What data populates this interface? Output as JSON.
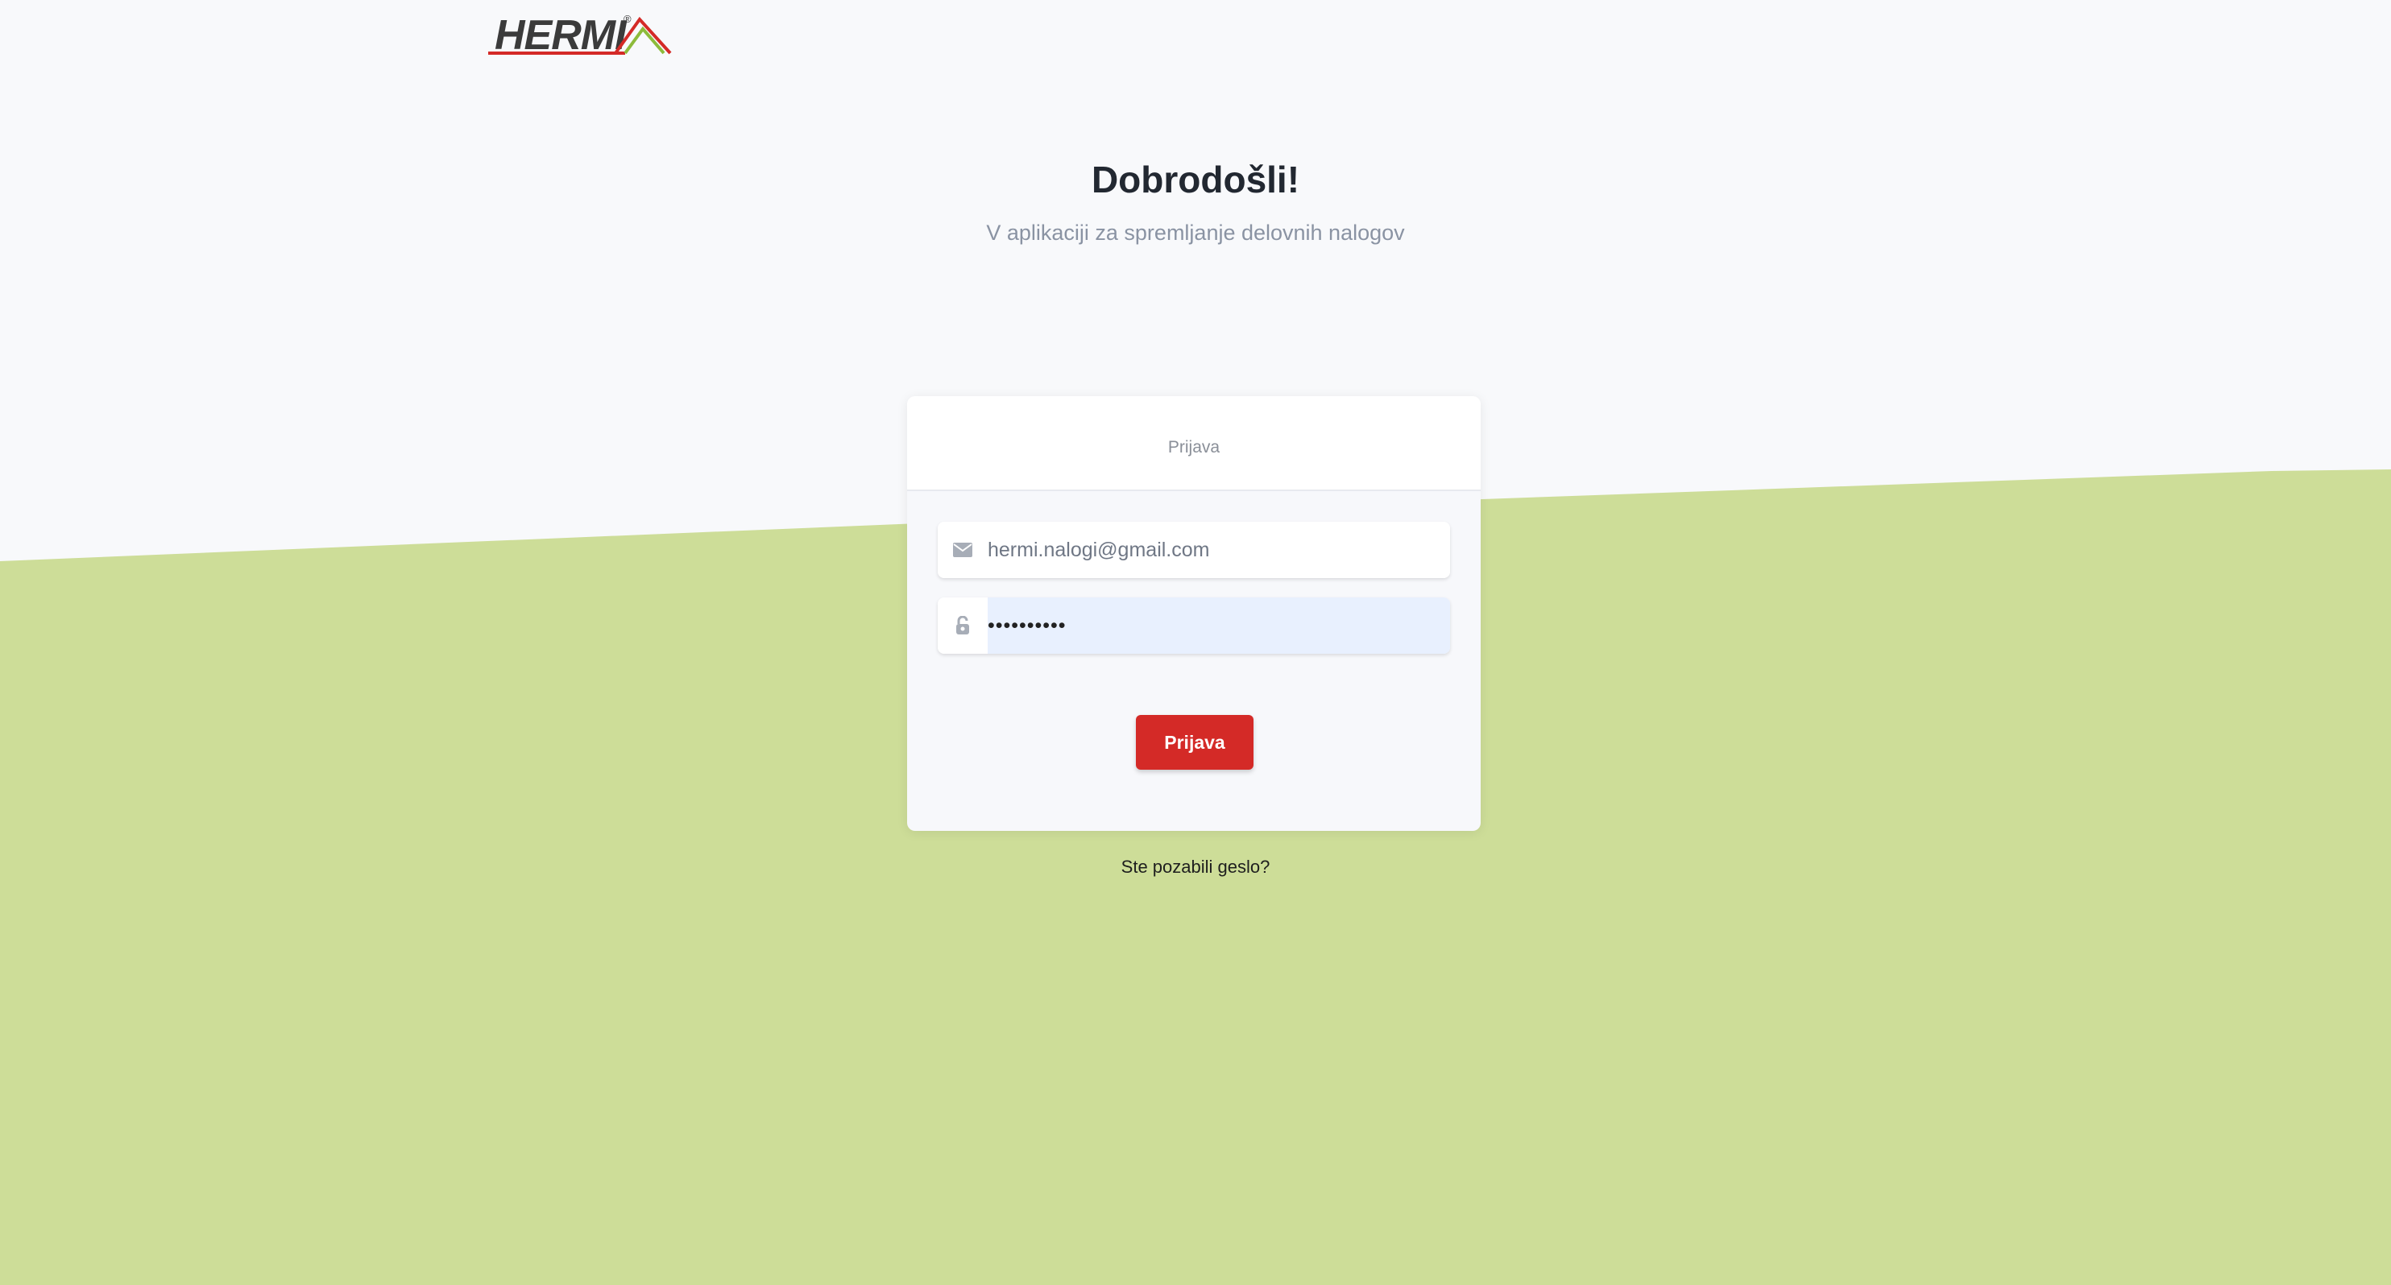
{
  "brand": {
    "logo_text": "HERMI",
    "logo_registered": "®",
    "colors": {
      "red": "#d42a27",
      "green": "#8dbb3b",
      "background_green": "#cddd98",
      "page_background": "#f8f9fb"
    }
  },
  "welcome": {
    "title": "Dobrodošli!",
    "subtitle": "V aplikaciji za spremljanje delovnih nalogov"
  },
  "login_card": {
    "header_title": "Prijava",
    "email": {
      "icon": "envelope-icon",
      "value": "hermi.nalogi@gmail.com"
    },
    "password": {
      "icon": "lock-icon",
      "value": "••••••••••"
    },
    "submit_label": "Prijava"
  },
  "forgot_password_label": "Ste pozabili geslo?"
}
